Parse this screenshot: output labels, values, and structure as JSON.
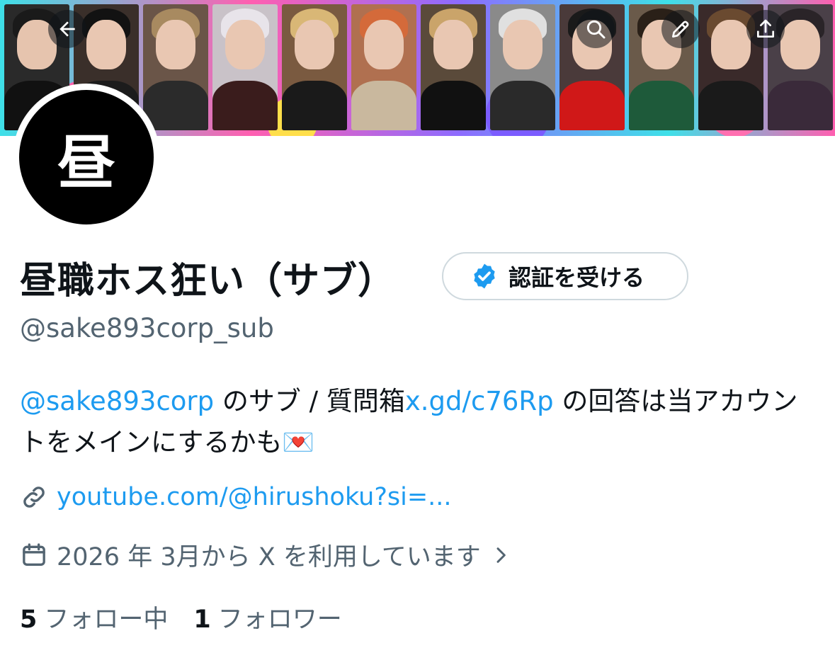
{
  "banner": {
    "back_icon": "arrow-left-icon",
    "search_icon": "search-icon",
    "edit_icon": "pencil-icon",
    "share_icon": "share-icon"
  },
  "avatar": {
    "text": "昼"
  },
  "profile": {
    "name": "昼職ホス狂い（サブ）",
    "verify_label": "認証を受ける",
    "handle": "@sake893corp_sub",
    "bio": {
      "mention": "@sake893corp",
      "text1": " のサブ / 質問箱",
      "link": "x.gd/c76Rp",
      "text2": " の回答は当アカウントをメインにするかも💌"
    },
    "url": "youtube.com/@hirushoku?si=...",
    "joined": "2026 年 3月から X を利用しています",
    "following_count": "5",
    "following_label": "フォロー中",
    "followers_count": "1",
    "followers_label": "フォロワー"
  },
  "colors": {
    "accent": "#1d9bf0",
    "secondary_text": "#536471",
    "primary_text": "#0f1419"
  }
}
